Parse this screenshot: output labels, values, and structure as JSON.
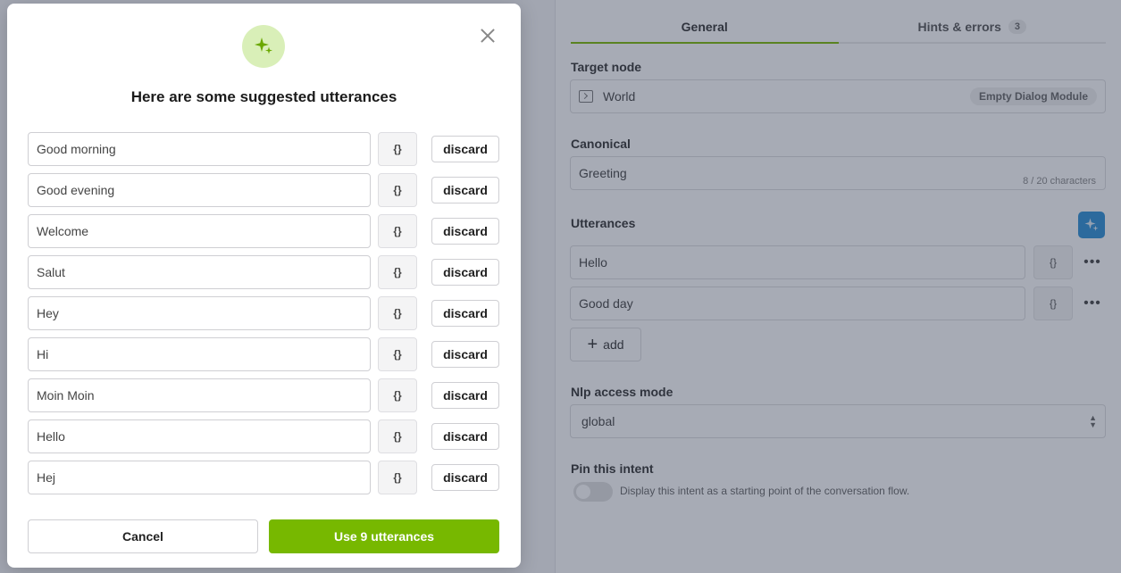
{
  "panel": {
    "tabs": [
      {
        "label": "General",
        "active": true
      },
      {
        "label": "Hints & errors",
        "badge": "3",
        "active": false
      }
    ],
    "target_node": {
      "label": "Target node",
      "value": "World",
      "tag": "Empty Dialog Module"
    },
    "canonical": {
      "label": "Canonical",
      "value": "Greeting",
      "char_count": "8 / 20 characters"
    },
    "utterances": {
      "label": "Utterances",
      "items": [
        {
          "text": "Hello",
          "var_label": "{}",
          "more": "•••"
        },
        {
          "text": "Good day",
          "var_label": "{}",
          "more": "•••"
        }
      ],
      "add_label": "add"
    },
    "nlp_access": {
      "label": "Nlp access mode",
      "value": "global"
    },
    "pin": {
      "label": "Pin this intent",
      "description": "Display this intent as a starting point of the conversation flow.",
      "enabled": false
    }
  },
  "modal": {
    "title": "Here are some suggested utterances",
    "suggestions": [
      {
        "text": "Good morning",
        "var_label": "{}",
        "discard_label": "discard"
      },
      {
        "text": "Good evening",
        "var_label": "{}",
        "discard_label": "discard"
      },
      {
        "text": "Welcome",
        "var_label": "{}",
        "discard_label": "discard"
      },
      {
        "text": "Salut",
        "var_label": "{}",
        "discard_label": "discard"
      },
      {
        "text": "Hey",
        "var_label": "{}",
        "discard_label": "discard"
      },
      {
        "text": "Hi",
        "var_label": "{}",
        "discard_label": "discard"
      },
      {
        "text": "Moin Moin",
        "var_label": "{}",
        "discard_label": "discard"
      },
      {
        "text": "Hello",
        "var_label": "{}",
        "discard_label": "discard"
      },
      {
        "text": "Hej",
        "var_label": "{}",
        "discard_label": "discard"
      }
    ],
    "cancel_label": "Cancel",
    "confirm_label": "Use 9 utterances"
  },
  "colors": {
    "accent": "#77b800",
    "overlay": "#2d364e",
    "ai_button": "#2c8fd6",
    "badge_bg": "#d9efb8"
  },
  "icons": {
    "sparkle": "sparkle-icon",
    "close": "close-icon",
    "node": "terminal-node-icon",
    "plus": "plus-icon",
    "chevron": "chevron-updown-icon"
  }
}
